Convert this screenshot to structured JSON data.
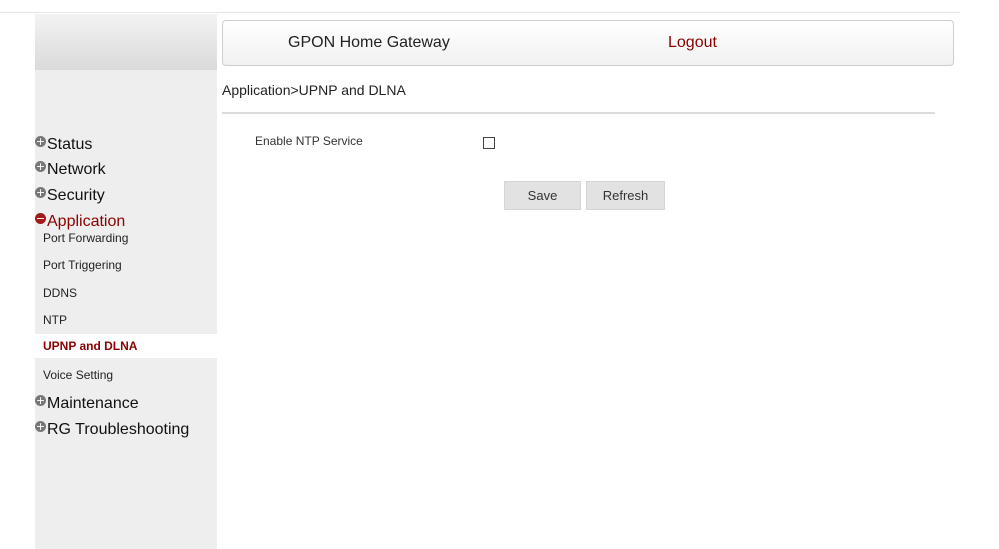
{
  "header": {
    "title": "GPON Home Gateway",
    "logout_label": "Logout"
  },
  "breadcrumb": "Application>UPNP and DLNA",
  "sidebar": {
    "top_items": [
      {
        "label": "Status",
        "icon": "plus"
      },
      {
        "label": "Network",
        "icon": "plus"
      },
      {
        "label": "Security",
        "icon": "plus"
      },
      {
        "label": "Application",
        "icon": "minus",
        "expanded": true
      }
    ],
    "sub_items": [
      {
        "label": "Port Forwarding"
      },
      {
        "label": "Port Triggering"
      },
      {
        "label": "DDNS"
      },
      {
        "label": "NTP"
      },
      {
        "label": "UPNP and DLNA",
        "selected": true
      },
      {
        "label": "Voice Setting"
      }
    ],
    "bottom_items": [
      {
        "label": "Maintenance",
        "icon": "plus"
      },
      {
        "label": "RG Troubleshooting",
        "icon": "plus"
      }
    ]
  },
  "form": {
    "enable_label": "Enable NTP Service",
    "enable_checked": false,
    "save_label": "Save",
    "refresh_label": "Refresh"
  },
  "colors": {
    "accent": "#8b0000",
    "sidebar_bg": "#eeeeee"
  }
}
